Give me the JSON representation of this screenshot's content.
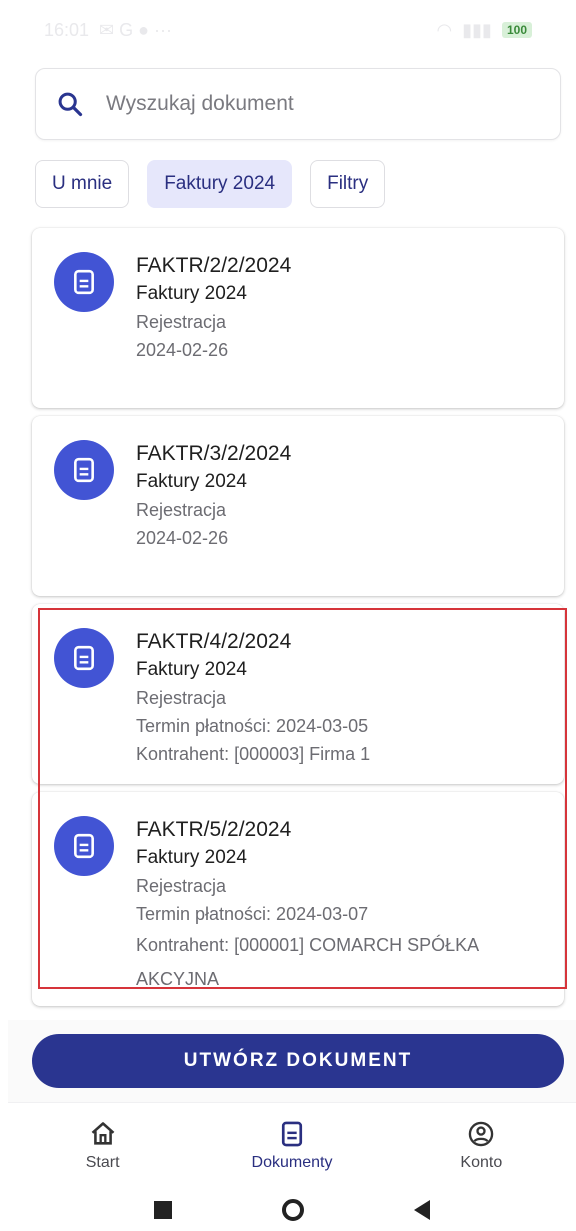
{
  "status_bar": {
    "time": "16:01",
    "battery": "100"
  },
  "search": {
    "placeholder": "Wyszukaj dokument",
    "value": ""
  },
  "chips": [
    {
      "label": "U mnie",
      "selected": false
    },
    {
      "label": "Faktury 2024",
      "selected": true
    },
    {
      "label": "Filtry",
      "selected": false
    }
  ],
  "documents": [
    {
      "number": "FAKTR/2/2/2024",
      "category": "Faktury 2024",
      "status": "Rejestracja",
      "date": "2024-02-26"
    },
    {
      "number": "FAKTR/3/2/2024",
      "category": "Faktury 2024",
      "status": "Rejestracja",
      "date": "2024-02-26"
    },
    {
      "number": "FAKTR/4/2/2024",
      "category": "Faktury 2024",
      "status": "Rejestracja",
      "payment_due": "Termin płatności: 2024-03-05",
      "contractor": "Kontrahent: [000003] Firma 1"
    },
    {
      "number": "FAKTR/5/2/2024",
      "category": "Faktury 2024",
      "status": "Rejestracja",
      "payment_due": "Termin płatności: 2024-03-07",
      "contractor": "Kontrahent: [000001] COMARCH SPÓŁKA AKCYJNA"
    }
  ],
  "create_button": {
    "label": "UTWÓRZ DOKUMENT"
  },
  "bottom_nav": [
    {
      "label": "Start",
      "icon": "home-icon"
    },
    {
      "label": "Dokumenty",
      "icon": "document-icon",
      "active": true
    },
    {
      "label": "Konto",
      "icon": "account-icon"
    }
  ],
  "colors": {
    "accent": "#2a3590",
    "avatar": "#4254d4",
    "chip_selected": "#e6e7fb",
    "highlight": "#d6343a"
  }
}
